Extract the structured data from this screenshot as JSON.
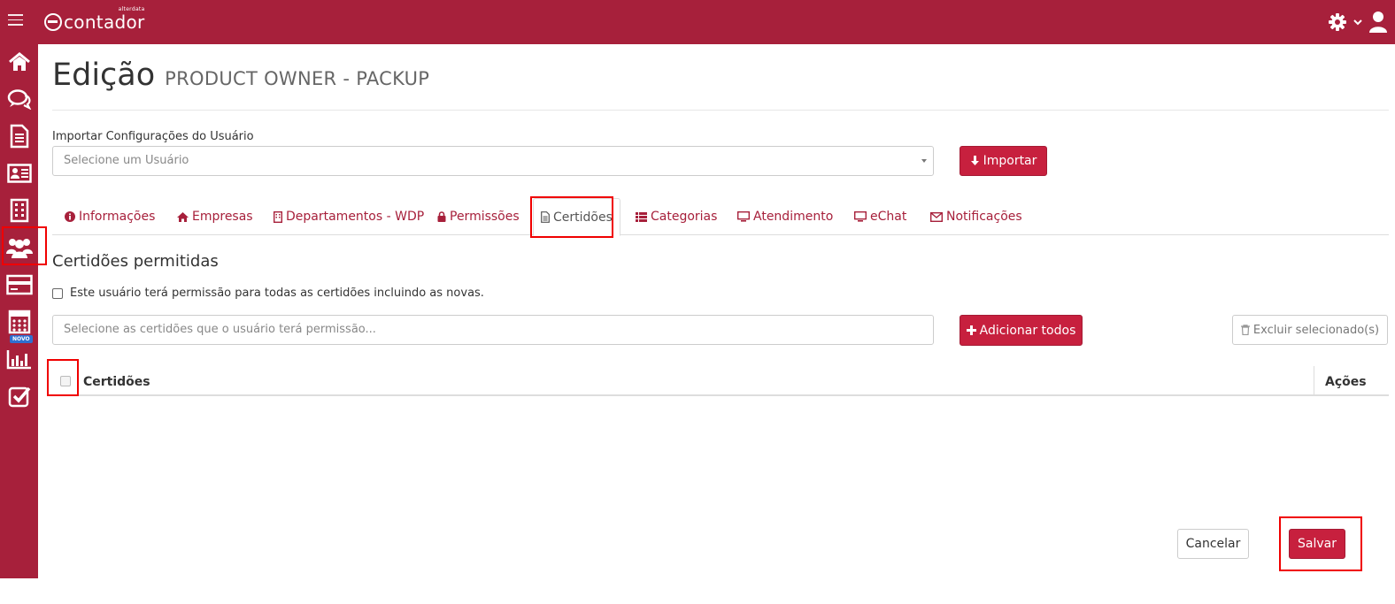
{
  "app": {
    "logo_text": "contador",
    "logo_small": "alterdata",
    "novo_badge": "NOVO"
  },
  "page": {
    "title": "Edição",
    "subtitle": "PRODUCT OWNER - PACKUP"
  },
  "import": {
    "label": "Importar Configurações do Usuário",
    "select_value": "Selecione um Usuário",
    "button_label": "Importar"
  },
  "tabs": [
    {
      "label": "Informações",
      "icon": "info-circle-icon"
    },
    {
      "label": "Empresas",
      "icon": "home-icon"
    },
    {
      "label": "Departamentos - WDP",
      "icon": "building-icon"
    },
    {
      "label": "Permissões",
      "icon": "lock-icon"
    },
    {
      "label": "Certidões",
      "icon": "file-text-icon",
      "active": true
    },
    {
      "label": "Categorias",
      "icon": "list-icon"
    },
    {
      "label": "Atendimento",
      "icon": "monitor-icon"
    },
    {
      "label": "eChat",
      "icon": "monitor-icon"
    },
    {
      "label": "Notificações",
      "icon": "envelope-icon"
    }
  ],
  "certidoes": {
    "section_title": "Certidões permitidas",
    "all_checkbox_label": "Este usuário terá permissão para todas as certidões incluindo as novas.",
    "search_placeholder": "Selecione as certidões que o usuário terá permissão...",
    "add_all_label": "Adicionar todos",
    "delete_selected_label": "Excluir selecionado(s)",
    "table": {
      "columns": [
        "Certidões",
        "Ações"
      ]
    }
  },
  "footer": {
    "cancel_label": "Cancelar",
    "save_label": "Salvar"
  },
  "colors": {
    "brand": "#a7203b",
    "button": "#c7203e",
    "highlight": "#f00000"
  },
  "sidebar_icons": [
    "home-icon",
    "chat-icon",
    "document-icon",
    "id-card-icon",
    "building-icon",
    "users-icon",
    "credit-card-icon",
    "calculator-icon",
    "bar-chart-icon",
    "checkbox-icon"
  ]
}
